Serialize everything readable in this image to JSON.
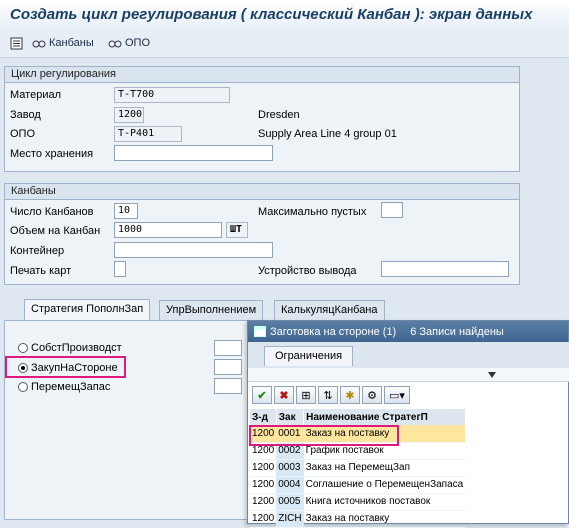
{
  "window": {
    "title": "Создать цикл регулирования ( классический Канбан ): экран данных"
  },
  "toolbar": {
    "kanbans_label": "Канбаны",
    "opo_label": "ОПО"
  },
  "cycle_group": {
    "title": "Цикл регулирования",
    "material_label": "Материал",
    "material_value": "T-T700",
    "plant_label": "Завод",
    "plant_value": "1200",
    "plant_name": "Dresden",
    "opo_label": "ОПО",
    "opo_value": "T-P401",
    "opo_desc": "Supply Area Line 4 group 01",
    "storage_label": "Место хранения",
    "storage_value": ""
  },
  "kanban_group": {
    "title": "Канбаны",
    "count_label": "Число Канбанов",
    "count_value": "10",
    "max_empty_label": "Максимально пустых",
    "max_empty_value": "",
    "volume_label": "Объем на Канбан",
    "volume_value": "1000",
    "unit_value": "ШТ",
    "container_label": "Контейнер",
    "container_value": "",
    "print_label": "Печать карт",
    "print_value": "",
    "output_device_label": "Устройство вывода",
    "output_device_value": ""
  },
  "tabs": [
    {
      "label": "Стратегия ПополнЗап"
    },
    {
      "label": "УпрВыполнением"
    },
    {
      "label": "КалькуляцКанбана"
    }
  ],
  "strategy": {
    "options": [
      {
        "label": "СобстПроизводст",
        "selected": false
      },
      {
        "label": "ЗакупНаСтороне",
        "selected": true
      },
      {
        "label": "ПеремещЗапас",
        "selected": false
      }
    ]
  },
  "popup": {
    "title": "Заготовка на стороне (1)",
    "count_text": "6 Записи найдены",
    "tab_label": "Ограничения",
    "columns": [
      "З-д",
      "Зак",
      "Наименование СтратегП"
    ],
    "rows": [
      [
        "1200",
        "0001",
        "Заказ на поставку"
      ],
      [
        "1200",
        "0002",
        "График поставок"
      ],
      [
        "1200",
        "0003",
        "Заказ на ПеремещЗап"
      ],
      [
        "1200",
        "0004",
        "Соглашение о ПеремещенЗапаса"
      ],
      [
        "1200",
        "0005",
        "Книга источников поставок"
      ],
      [
        "1200",
        "ZICH",
        "Заказ на поставку"
      ]
    ]
  },
  "colors": {
    "accent": "#1a3f66",
    "highlight": "#e0197d",
    "selected_row": "#ffe69e"
  }
}
